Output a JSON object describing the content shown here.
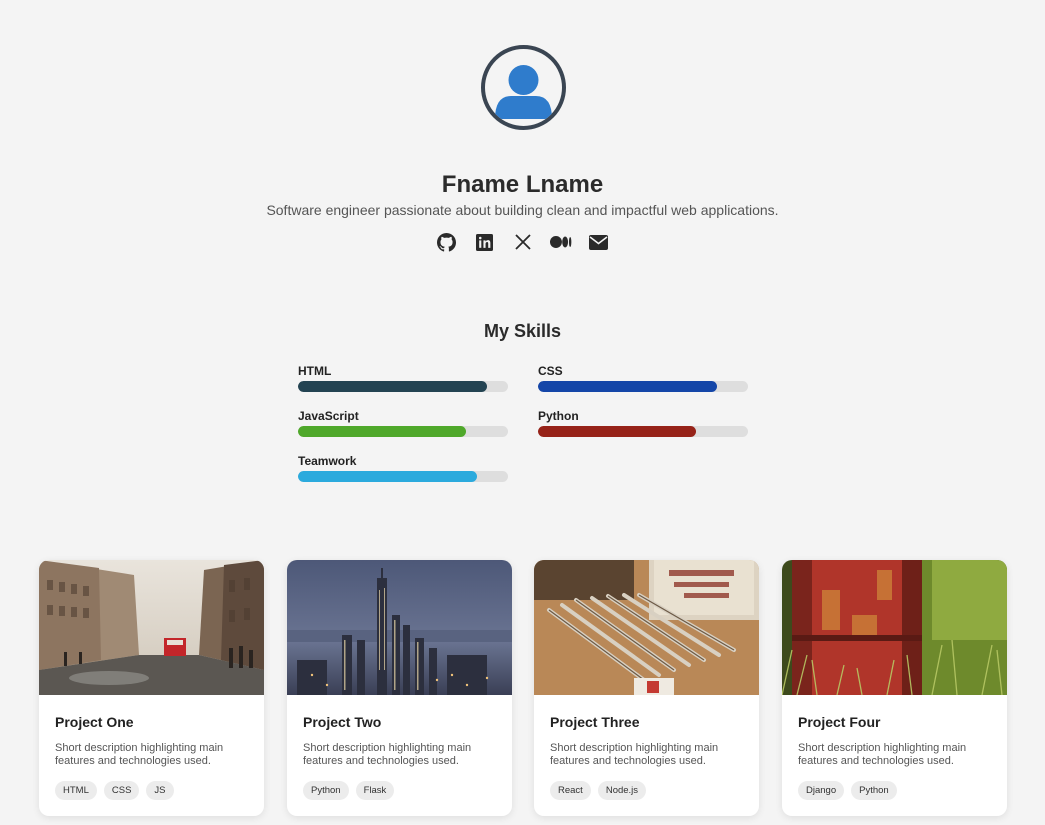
{
  "profile": {
    "name": "Fname Lname",
    "tagline": "Software engineer passionate about building clean and impactful web applications.",
    "avatar_colors": {
      "ring": "#3a4552",
      "figure": "#2f7ccc"
    },
    "socials": [
      {
        "icon": "github-icon",
        "label": "GitHub"
      },
      {
        "icon": "linkedin-icon",
        "label": "LinkedIn"
      },
      {
        "icon": "x-icon",
        "label": "X"
      },
      {
        "icon": "medium-icon",
        "label": "Medium"
      },
      {
        "icon": "email-icon",
        "label": "Email"
      }
    ]
  },
  "skills": {
    "title": "My Skills",
    "items": [
      {
        "name": "HTML",
        "level": 0.9,
        "color": "#234352"
      },
      {
        "name": "CSS",
        "level": 0.85,
        "color": "#1446a8"
      },
      {
        "name": "JavaScript",
        "level": 0.8,
        "color": "#4fa82a"
      },
      {
        "name": "Python",
        "level": 0.75,
        "color": "#962218"
      },
      {
        "name": "Teamwork",
        "level": 0.85,
        "color": "#2baadd"
      }
    ]
  },
  "projects": [
    {
      "title": "Project One",
      "description": "Short description highlighting main features and technologies used.",
      "tags": [
        "HTML",
        "CSS",
        "JS"
      ],
      "image": "city-street-photo"
    },
    {
      "title": "Project Two",
      "description": "Short description highlighting main features and technologies used.",
      "tags": [
        "Python",
        "Flask"
      ],
      "image": "city-skyline-photo"
    },
    {
      "title": "Project Three",
      "description": "Short description highlighting main features and technologies used.",
      "tags": [
        "React",
        "Node.js"
      ],
      "image": "pencils-photo"
    },
    {
      "title": "Project Four",
      "description": "Short description highlighting main features and technologies used.",
      "tags": [
        "Django",
        "Python"
      ],
      "image": "rusty-barrel-photo"
    }
  ]
}
